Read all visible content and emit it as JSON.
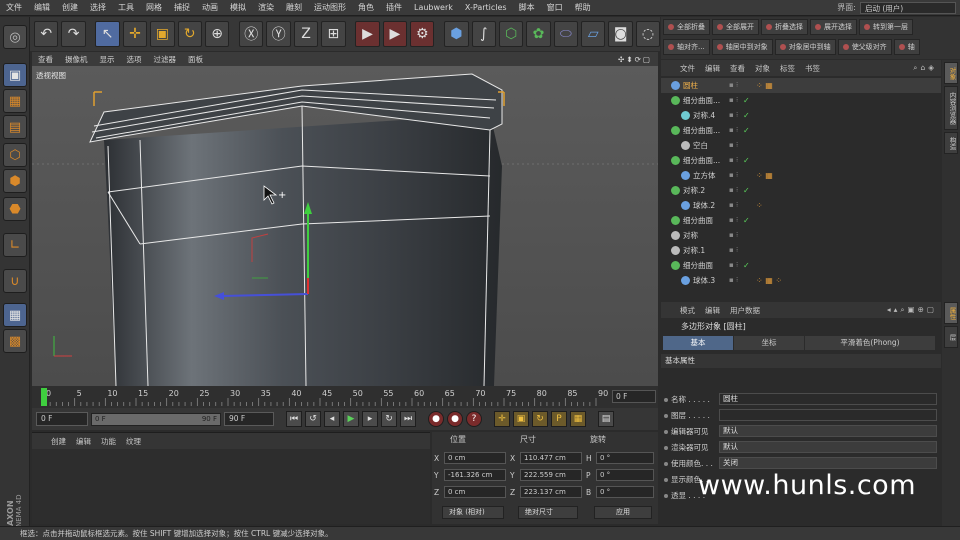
{
  "menubar": {
    "items": [
      "文件",
      "编辑",
      "创建",
      "选择",
      "工具",
      "网格",
      "捕捉",
      "动画",
      "模拟",
      "渲染",
      "雕刻",
      "运动图形",
      "角色",
      "插件",
      "Laubwerk",
      "X-Particles",
      "脚本",
      "窗口",
      "帮助"
    ],
    "layout_label": "界面:",
    "layout_value": "启动 (用户)"
  },
  "right_toolbar": {
    "row1": [
      "全部折叠",
      "全部展开",
      "折叠选择",
      "展开选择",
      "转到第一层"
    ],
    "row2": [
      "轴对齐...",
      "轴居中到对象",
      "对象居中到轴",
      "使父级对齐",
      "轴"
    ]
  },
  "viewport": {
    "menu": [
      "查看",
      "摄像机",
      "显示",
      "选项",
      "过滤器",
      "面板"
    ],
    "label": "透视视图",
    "nav_icons": "✣⬍⟳▢"
  },
  "timeline": {
    "ticks": [
      "0",
      "5",
      "10",
      "15",
      "20",
      "25",
      "30",
      "35",
      "40",
      "45",
      "50",
      "55",
      "60",
      "65",
      "70",
      "75",
      "80",
      "85",
      "90"
    ],
    "current_frame_field": "0 F"
  },
  "transport": {
    "start_field": "0 F",
    "slider_left": "0 F",
    "slider_right": "90 F",
    "end_field": "90 F"
  },
  "material": {
    "menu": [
      "创建",
      "编辑",
      "功能",
      "纹理"
    ]
  },
  "coordinates": {
    "headers": [
      "位置",
      "尺寸",
      "旋转"
    ],
    "rows": [
      {
        "axis": "X",
        "pos": "0 cm",
        "size_axis": "X",
        "size": "110.477 cm",
        "rot_axis": "H",
        "rot": "0 °"
      },
      {
        "axis": "Y",
        "pos": "-161.326 cm",
        "size_axis": "Y",
        "size": "222.559 cm",
        "rot_axis": "P",
        "rot": "0 °"
      },
      {
        "axis": "Z",
        "pos": "0 cm",
        "size_axis": "Z",
        "size": "223.137 cm",
        "rot_axis": "B",
        "rot": "0 °"
      }
    ],
    "mode_select": "对象 (相对)",
    "size_select": "绝对尺寸",
    "apply_label": "应用"
  },
  "status": {
    "text": "框选：点击并拖动鼠标框选元素。按住 SHIFT 键增加选择对象；按住 CTRL 键减少选择对象。"
  },
  "object_manager": {
    "menu": [
      "文件",
      "编辑",
      "查看",
      "对象",
      "标签",
      "书签"
    ],
    "objects": [
      {
        "name": "圆柱",
        "depth": 0,
        "icon_color": "#6aa0e0",
        "selected": true,
        "check": false,
        "tags": "⁘ ▦"
      },
      {
        "name": "细分曲面...",
        "depth": 0,
        "icon_color": "#59b85a",
        "selected": false,
        "check": true,
        "tags": ""
      },
      {
        "name": "对称.4",
        "depth": 1,
        "icon_color": "#6fcad0",
        "selected": false,
        "check": true,
        "tags": ""
      },
      {
        "name": "细分曲面...",
        "depth": 0,
        "icon_color": "#59b85a",
        "selected": false,
        "check": true,
        "tags": ""
      },
      {
        "name": "空白",
        "depth": 1,
        "icon_color": "#bbbbbb",
        "selected": false,
        "check": false,
        "tags": ""
      },
      {
        "name": "细分曲面...",
        "depth": 0,
        "icon_color": "#59b85a",
        "selected": false,
        "check": true,
        "tags": ""
      },
      {
        "name": "立方体",
        "depth": 1,
        "icon_color": "#6aa0e0",
        "selected": false,
        "check": false,
        "tags": "⁘ ▦"
      },
      {
        "name": "对称.2",
        "depth": 0,
        "icon_color": "#59b85a",
        "selected": false,
        "check": true,
        "tags": ""
      },
      {
        "name": "球体.2",
        "depth": 1,
        "icon_color": "#6aa0e0",
        "selected": false,
        "check": false,
        "tags": "⁘"
      },
      {
        "name": "细分曲面",
        "depth": 0,
        "icon_color": "#59b85a",
        "selected": false,
        "check": true,
        "tags": ""
      },
      {
        "name": "对称",
        "depth": 0,
        "icon_color": "#bbbbbb",
        "selected": false,
        "check": false,
        "tags": ""
      },
      {
        "name": "对称.1",
        "depth": 0,
        "icon_color": "#bbbbbb",
        "selected": false,
        "check": false,
        "tags": ""
      },
      {
        "name": "细分曲面",
        "depth": 0,
        "icon_color": "#59b85a",
        "selected": false,
        "check": true,
        "tags": ""
      },
      {
        "name": "球体.3",
        "depth": 1,
        "icon_color": "#6aa0e0",
        "selected": false,
        "check": false,
        "tags": "⁘ ▦ ⁘"
      }
    ]
  },
  "attribute_manager": {
    "menu": [
      "模式",
      "编辑",
      "用户数据"
    ],
    "title": "多边形对象 [圆柱]",
    "tabs": [
      "基本",
      "坐标",
      "平滑着色(Phong)"
    ],
    "section": "基本属性",
    "fields": [
      {
        "label": "名称 . . . . .",
        "value": "圆柱"
      },
      {
        "label": "图层 . . . . .",
        "value": ""
      },
      {
        "label": "编辑器可见",
        "value": "默认"
      },
      {
        "label": "渲染器可见",
        "value": "默认"
      },
      {
        "label": "使用颜色. . .",
        "value": "关闭"
      },
      {
        "label": "显示颜色. .",
        "value": ""
      },
      {
        "label": "透显 . . . .",
        "value": ""
      }
    ]
  },
  "vertical_tabs": [
    "对象",
    "内容浏览器",
    "构造",
    "属性",
    "层"
  ],
  "watermark": "www.hunls.com",
  "branding": {
    "maxon": "MAXON",
    "cinema": "CINEMA 4D"
  },
  "colors": {
    "accent": "#4f6789",
    "selection": "#f0b04a",
    "viewport_bg": "#555555"
  }
}
